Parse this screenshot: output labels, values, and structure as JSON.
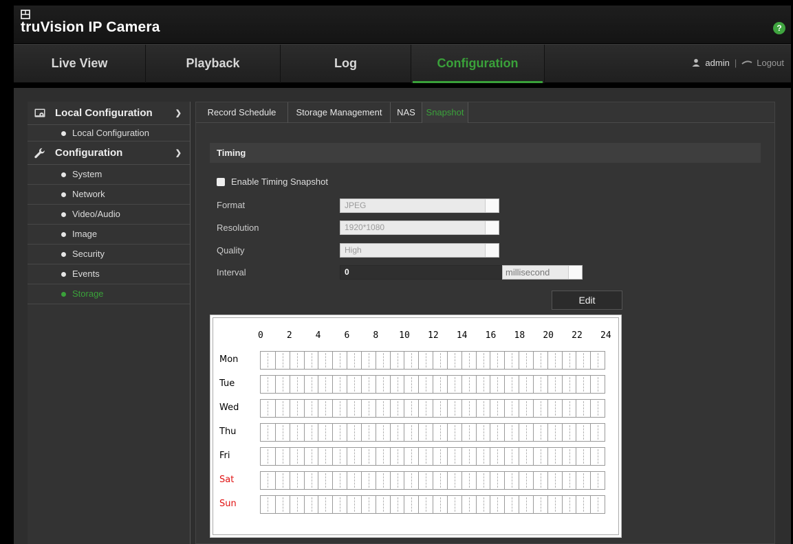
{
  "app": {
    "title": "truVision  IP Camera",
    "help_label": "?"
  },
  "nav": {
    "tabs": [
      {
        "label": "Live View"
      },
      {
        "label": "Playback"
      },
      {
        "label": "Log"
      },
      {
        "label": "Configuration",
        "active": true
      }
    ],
    "user": "admin",
    "separator": "|",
    "logout": "Logout"
  },
  "sidebar": {
    "groups": [
      {
        "label": "Local Configuration",
        "icon": "local-config-icon",
        "items": [
          "Local Configuration"
        ]
      },
      {
        "label": "Configuration",
        "icon": "wrench-icon",
        "items": [
          "System",
          "Network",
          "Video/Audio",
          "Image",
          "Security",
          "Events",
          "Storage"
        ]
      }
    ],
    "active_item": "Storage",
    "accent": "#3aa13a"
  },
  "subtabs": [
    "Record Schedule",
    "Storage Management",
    "NAS",
    "Snapshot"
  ],
  "active_subtab": "Snapshot",
  "timing": {
    "header": "Timing",
    "enable_label": "Enable Timing Snapshot",
    "enable_checked": false,
    "format_label": "Format",
    "format_value": "JPEG",
    "resolution_label": "Resolution",
    "resolution_value": "1920*1080",
    "quality_label": "Quality",
    "quality_value": "High",
    "interval_label": "Interval",
    "interval_value": "0",
    "interval_unit": "millisecond",
    "edit_label": "Edit"
  },
  "schedule": {
    "hours": [
      "0",
      "2",
      "4",
      "6",
      "8",
      "10",
      "12",
      "14",
      "16",
      "18",
      "20",
      "22",
      "24"
    ],
    "days": [
      {
        "label": "Mon",
        "weekend": false
      },
      {
        "label": "Tue",
        "weekend": false
      },
      {
        "label": "Wed",
        "weekend": false
      },
      {
        "label": "Thu",
        "weekend": false
      },
      {
        "label": "Fri",
        "weekend": false
      },
      {
        "label": "Sat",
        "weekend": true
      },
      {
        "label": "Sun",
        "weekend": true
      }
    ],
    "weekend_color": "#e01010"
  }
}
